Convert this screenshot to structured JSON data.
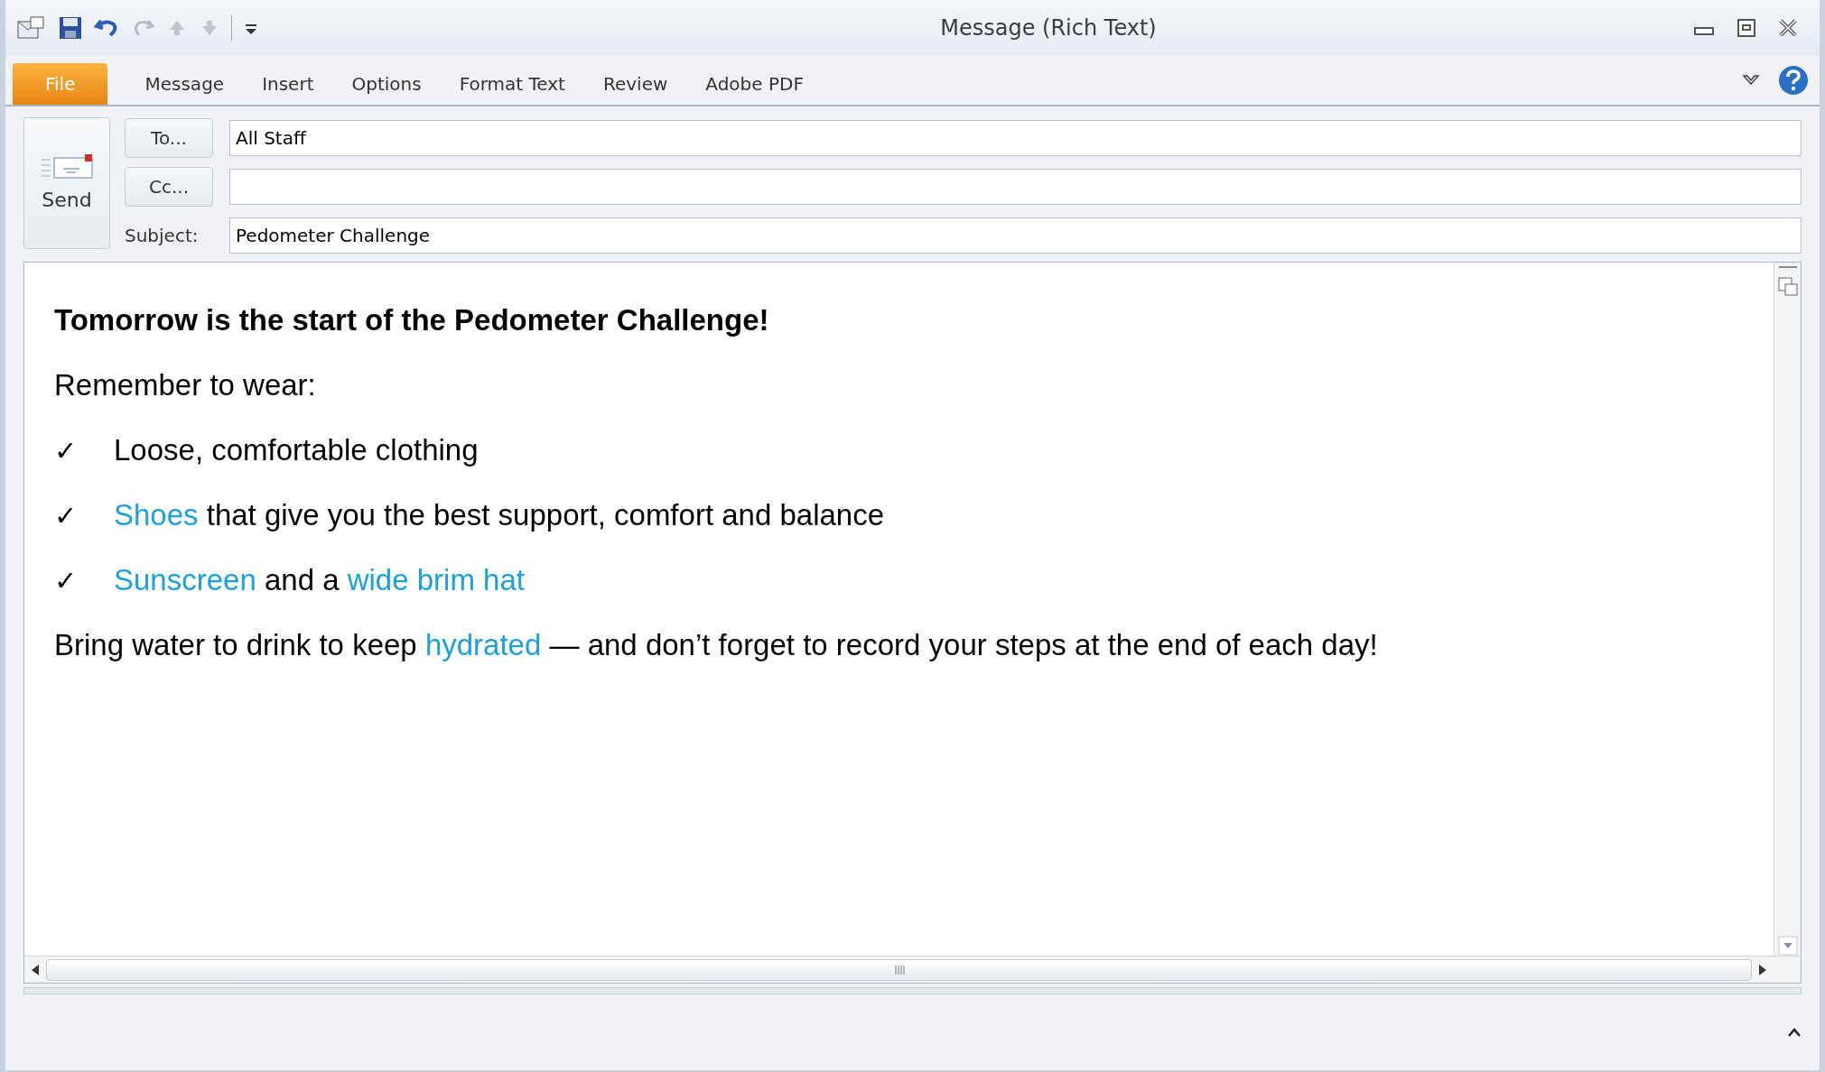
{
  "window": {
    "title": "Message (Rich Text)"
  },
  "ribbon_tabs": [
    {
      "label": "File",
      "kind": "file"
    },
    {
      "label": "Message",
      "kind": "tab"
    },
    {
      "label": "Insert",
      "kind": "tab"
    },
    {
      "label": "Options",
      "kind": "tab"
    },
    {
      "label": "Format Text",
      "kind": "tab"
    },
    {
      "label": "Review",
      "kind": "tab"
    },
    {
      "label": "Adobe PDF",
      "kind": "tab"
    }
  ],
  "header": {
    "send_button": "Send",
    "fields": [
      {
        "button": "To...",
        "value": "All Staff"
      },
      {
        "button": "Cc..."
      },
      {
        "label": "Subject:",
        "value": "Pedometer Challenge"
      }
    ]
  },
  "body": [
    {
      "kind": "heading",
      "parts": [
        {
          "text": "Tomorrow is the start of the Pedometer Challenge!"
        }
      ]
    },
    {
      "kind": "paragraph",
      "parts": [
        {
          "text": "Remember to wear:"
        }
      ]
    },
    {
      "kind": "check_item",
      "mark": "✓",
      "parts": [
        {
          "text": "Loose, comfortable clothing"
        }
      ]
    },
    {
      "kind": "check_item",
      "mark": "✓",
      "parts": [
        {
          "text": "Shoes",
          "link": true
        },
        {
          "text": " that give you the best support, comfort and balance"
        }
      ]
    },
    {
      "kind": "check_item",
      "mark": "✓",
      "parts": [
        {
          "text": "Sunscreen",
          "link": true
        },
        {
          "text": " and a "
        },
        {
          "text": "wide brim hat",
          "link": true
        }
      ]
    },
    {
      "kind": "paragraph",
      "parts": [
        {
          "text": "Bring water to drink to keep "
        },
        {
          "text": "hydrated",
          "link": true
        },
        {
          "text": " — and don’t forget to record your steps at the end of each day!"
        }
      ]
    }
  ]
}
